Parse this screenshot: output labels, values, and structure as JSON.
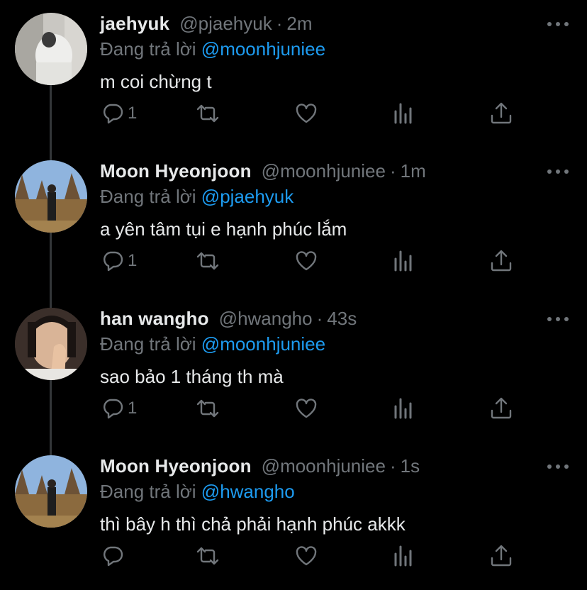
{
  "replying_prefix": "Đang trả lời",
  "colors": {
    "background": "#000000",
    "name": "#e7e9ea",
    "muted": "#71767b",
    "mention": "#1d9bf0"
  },
  "tweets": [
    {
      "name": "jaehyuk",
      "handle": "@pjaehyuk",
      "dot": "·",
      "time": "2m",
      "replying_to": "@moonhjuniee",
      "text": "m coi chừng t",
      "reply_count": "1",
      "avatar": "avatar-white-jacket"
    },
    {
      "name": "Moon Hyeonjoon",
      "handle": "@moonhjuniee",
      "dot": "·",
      "time": "1m",
      "replying_to": "@pjaehyuk",
      "text": "a yên tâm tụi e hạnh phúc lắm",
      "reply_count": "1",
      "avatar": "avatar-field-trees"
    },
    {
      "name": "han wangho",
      "handle": "@hwangho",
      "dot": "·",
      "time": "43s",
      "replying_to": "@moonhjuniee",
      "text": "sao bảo 1 tháng th mà",
      "reply_count": "1",
      "avatar": "avatar-hand-face"
    },
    {
      "name": "Moon Hyeonjoon",
      "handle": "@moonhjuniee",
      "dot": "·",
      "time": "1s",
      "replying_to": "@hwangho",
      "text": "thì bây h thì chả phải hạnh phúc akkk",
      "reply_count": "",
      "avatar": "avatar-field-trees"
    }
  ]
}
